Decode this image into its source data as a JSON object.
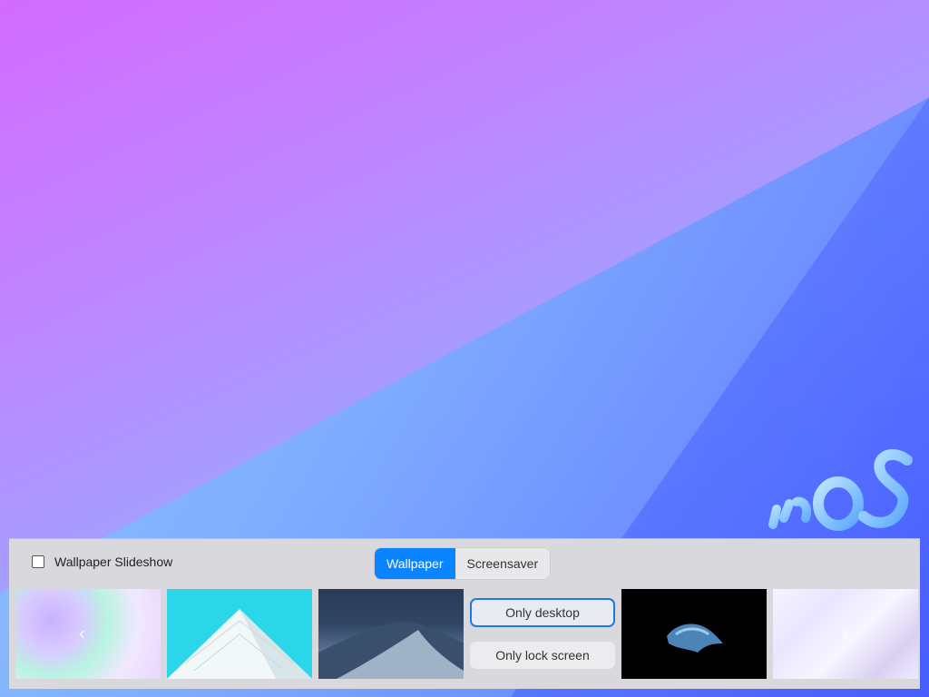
{
  "panel": {
    "slideshow_label": "Wallpaper Slideshow",
    "tabs": [
      {
        "label": "Wallpaper",
        "active": true
      },
      {
        "label": "Screensaver",
        "active": false
      }
    ],
    "actions": {
      "only_desktop": "Only desktop",
      "only_lock_screen": "Only lock screen"
    },
    "nav": {
      "prev_icon": "chevron-left-icon",
      "next_icon": "chevron-right-icon"
    }
  },
  "colors": {
    "accent": "#0a84ff",
    "panel_bg": "#d9d9dd"
  }
}
